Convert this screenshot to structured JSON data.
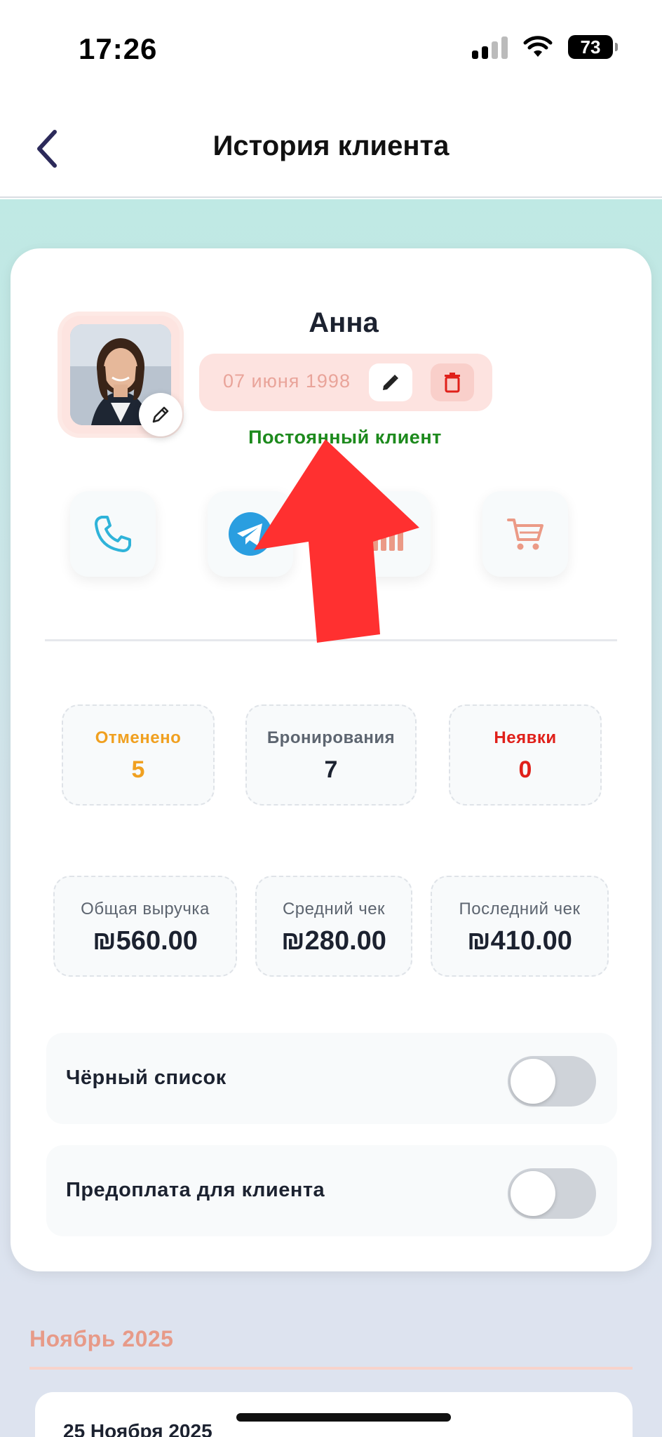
{
  "status_bar": {
    "time": "17:26",
    "battery": "73"
  },
  "nav": {
    "title": "История клиента"
  },
  "client": {
    "name": "Анна",
    "birth_date": "07 июня 1998",
    "status": "Постоянный клиент"
  },
  "actions": [
    {
      "icon": "phone-icon"
    },
    {
      "icon": "telegram-icon"
    },
    {
      "icon": "bar-chart-icon"
    },
    {
      "icon": "cart-icon"
    }
  ],
  "counts": {
    "cancelled": {
      "label": "Отменено",
      "value": "5"
    },
    "bookings": {
      "label": "Бронирования",
      "value": "7"
    },
    "no_shows": {
      "label": "Неявки",
      "value": "0"
    }
  },
  "finance": {
    "total_revenue": {
      "label": "Общая выручка",
      "value": "₪560.00"
    },
    "average_check": {
      "label": "Средний чек",
      "value": "₪280.00"
    },
    "last_check": {
      "label": "Последний чек",
      "value": "₪410.00"
    }
  },
  "settings": {
    "blacklist": {
      "label": "Чёрный список",
      "on": false
    },
    "prepayment": {
      "label": "Предоплата для клиента",
      "on": false
    }
  },
  "history": {
    "month": "Ноябрь 2025",
    "first_visit_date": "25 Ноября 2025"
  },
  "colors": {
    "accent": "#e79a88",
    "cancelled": "#f0a020",
    "no_shows": "#e0201a",
    "status_green": "#1d8a1d",
    "nav_back": "#2c2a5a",
    "annotation_arrow": "#ff3030"
  }
}
